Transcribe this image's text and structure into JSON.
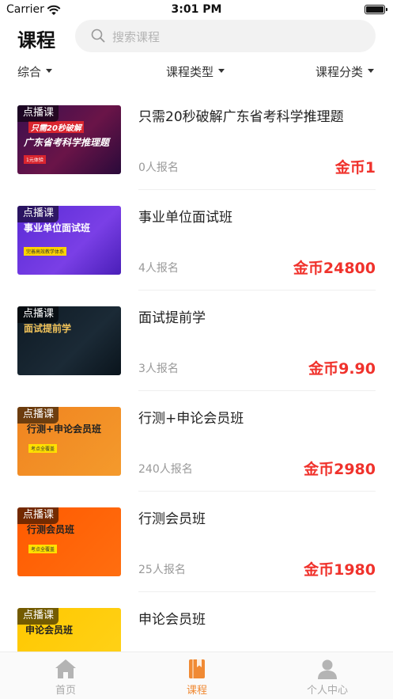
{
  "status_bar": {
    "carrier": "Carrier",
    "time": "3:01 PM"
  },
  "header": {
    "title": "课程",
    "search_placeholder": "搜索课程"
  },
  "filters": [
    "综合",
    "课程类型",
    "课程分类"
  ],
  "courses": [
    {
      "tag": "点播课",
      "banner": "广东省考科学推理题",
      "banner_top": "只需20秒破解",
      "ribbon": "1元体验",
      "title": "只需20秒破解广东省考科学推理题",
      "enrolled": "0人报名",
      "price": "金币1"
    },
    {
      "tag": "点播课",
      "banner": "事业单位面试班",
      "banner_top": "",
      "ribbon": "完善高效教学体系",
      "title": "事业单位面试班",
      "enrolled": "4人报名",
      "price": "金币24800"
    },
    {
      "tag": "点播课",
      "banner": "面试提前学",
      "banner_top": "",
      "ribbon": "",
      "title": "面试提前学",
      "enrolled": "3人报名",
      "price": "金币9.90"
    },
    {
      "tag": "点播课",
      "banner": "行测+申论会员班",
      "banner_top": "",
      "ribbon": "考点全覆盖",
      "title": "行测+申论会员班",
      "enrolled": "240人报名",
      "price": "金币2980"
    },
    {
      "tag": "点播课",
      "banner": "行测会员班",
      "banner_top": "",
      "ribbon": "考点全覆盖",
      "title": "行测会员班",
      "enrolled": "25人报名",
      "price": "金币1980"
    },
    {
      "tag": "点播课",
      "banner": "申论会员班",
      "banner_top": "",
      "ribbon": "",
      "title": "申论会员班",
      "enrolled": "",
      "price": ""
    }
  ],
  "tabbar": [
    {
      "label": "首页",
      "icon": "home-icon",
      "active": false
    },
    {
      "label": "课程",
      "icon": "book-icon",
      "active": true
    },
    {
      "label": "个人中心",
      "icon": "person-icon",
      "active": false
    }
  ],
  "colors": {
    "accent": "#f08a34",
    "price": "#f0322c",
    "muted": "#999999"
  }
}
